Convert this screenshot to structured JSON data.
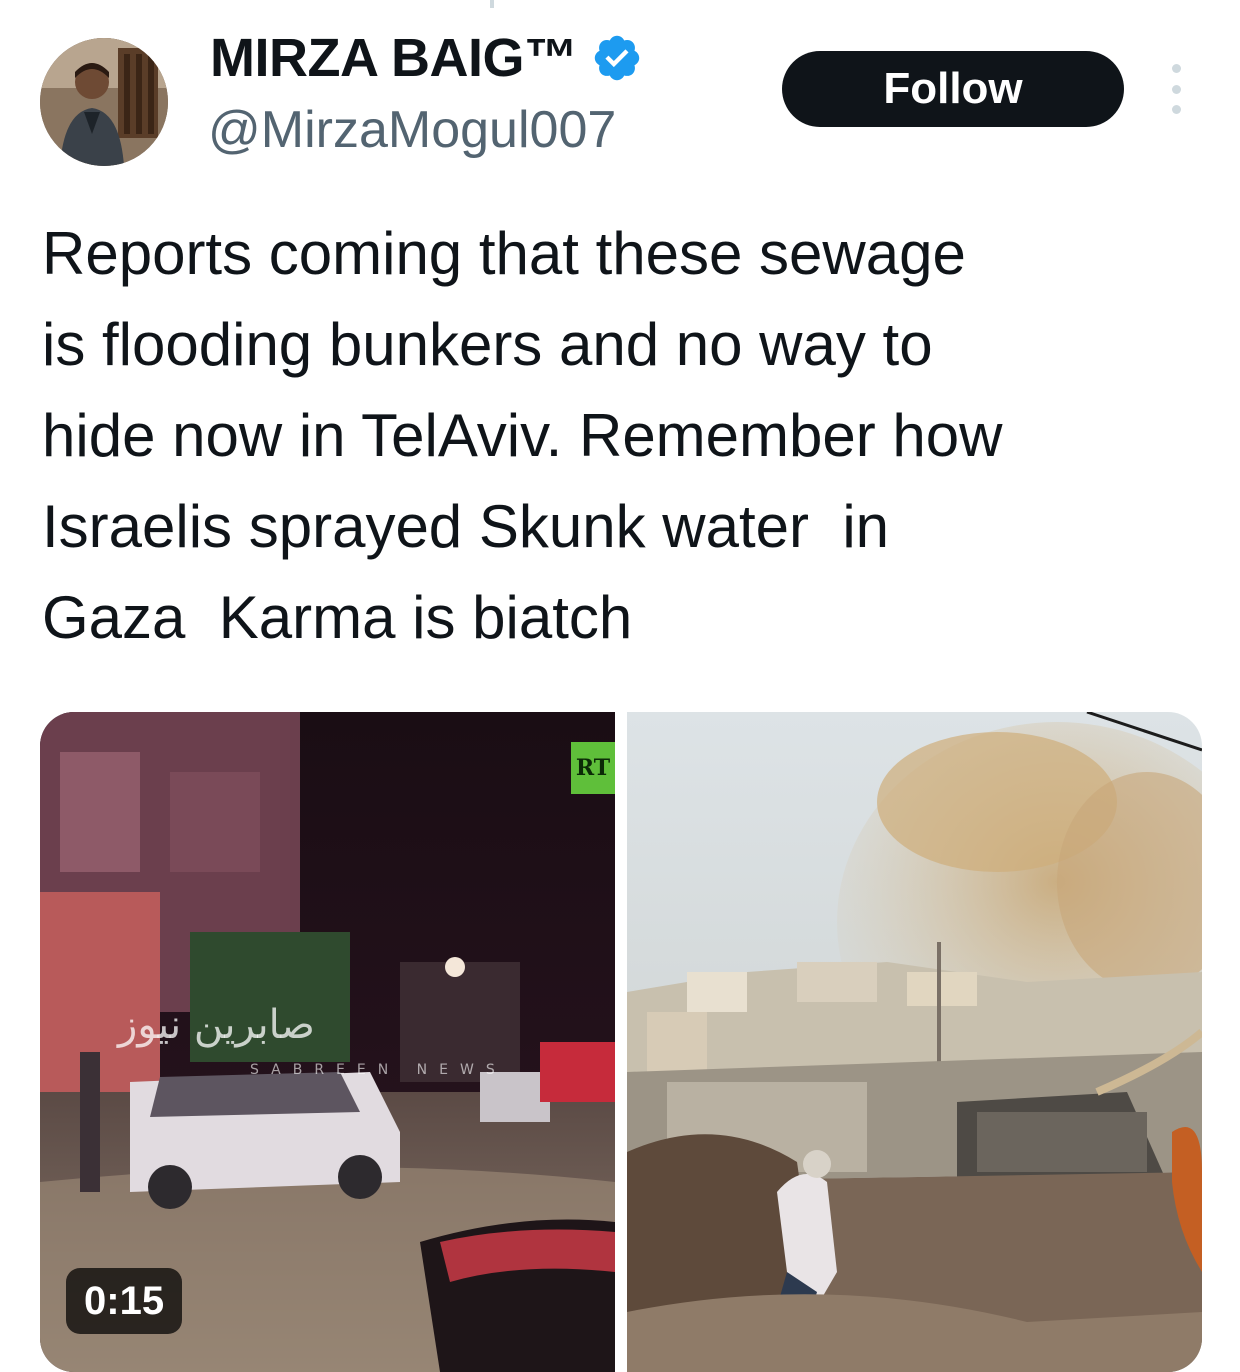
{
  "author": {
    "display_name": "MIRZA BAIG™",
    "handle": "@MirzaMogul007",
    "verified": true,
    "avatar_icon": "profile-photo"
  },
  "actions": {
    "follow_label": "Follow",
    "more_icon": "more-vertical-icon"
  },
  "tweet": {
    "text": "Reports coming that these sewage\nis flooding bunkers and no way to\nhide now in TelAviv. Remember how\nIsraelis sprayed Skunk water  in\nGaza  Karma is biatch"
  },
  "media": {
    "video": {
      "duration": "0:15",
      "channel_logo": "RT",
      "watermark_text": "صابرين نيوز",
      "watermark_sub": "SABREEN NEWS"
    },
    "photo": {
      "description_icon": "photo"
    }
  },
  "colors": {
    "text": "#0f1419",
    "secondary_text": "#536471",
    "verified_blue": "#1d9bf0",
    "button_bg": "#0f1419"
  }
}
